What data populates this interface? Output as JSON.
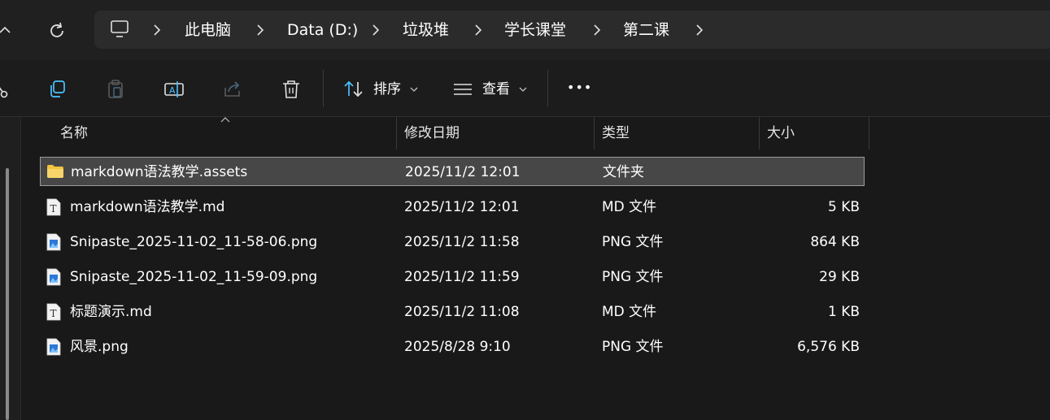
{
  "breadcrumb": [
    "此电脑",
    "Data (D:)",
    "垃圾堆",
    "学长课堂",
    "第二课"
  ],
  "toolbar": {
    "sort_label": "排序",
    "view_label": "查看",
    "more_label": "•••"
  },
  "columns": {
    "name": "名称",
    "date": "修改日期",
    "type": "类型",
    "size": "大小"
  },
  "files": [
    {
      "name": "markdown语法教学.assets",
      "date": "2025/11/2 12:01",
      "type": "文件夹",
      "size": "",
      "icon": "folder-icon",
      "selected": true
    },
    {
      "name": "markdown语法教学.md",
      "date": "2025/11/2 12:01",
      "type": "MD 文件",
      "size": "5 KB",
      "icon": "text-file-icon",
      "selected": false
    },
    {
      "name": "Snipaste_2025-11-02_11-58-06.png",
      "date": "2025/11/2 11:58",
      "type": "PNG 文件",
      "size": "864 KB",
      "icon": "image-file-icon",
      "selected": false
    },
    {
      "name": "Snipaste_2025-11-02_11-59-09.png",
      "date": "2025/11/2 11:59",
      "type": "PNG 文件",
      "size": "29 KB",
      "icon": "image-file-icon",
      "selected": false
    },
    {
      "name": "标题演示.md",
      "date": "2025/11/2 11:08",
      "type": "MD 文件",
      "size": "1 KB",
      "icon": "text-file-icon",
      "selected": false
    },
    {
      "name": "风景.png",
      "date": "2025/8/28 9:10",
      "type": "PNG 文件",
      "size": "6,576 KB",
      "icon": "image-file-icon",
      "selected": false
    }
  ],
  "colors": {
    "background": "#191919",
    "selection": "#474747",
    "folder": "#f3c33c",
    "accent": "#4cc2ff"
  }
}
